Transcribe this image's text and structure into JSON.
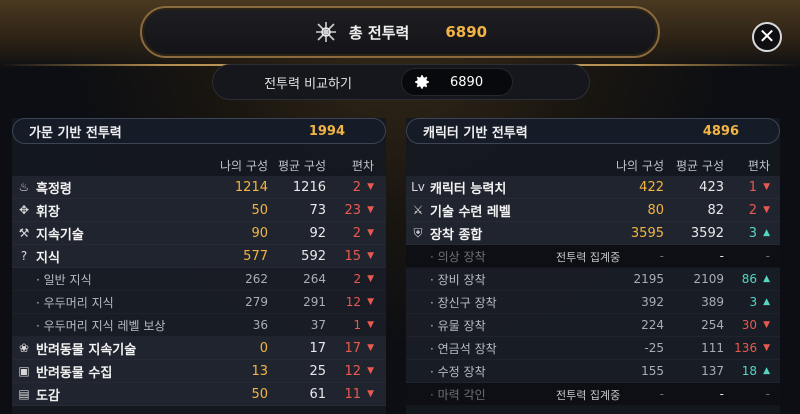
{
  "header": {
    "title": "총 전투력",
    "total": "6890",
    "close_icon": "close-icon",
    "title_icon": "combat-power-icon"
  },
  "compare": {
    "label": "전투력 비교하기",
    "value": "6890",
    "icon": "gear-icon"
  },
  "columns": {
    "mine": "나의 구성",
    "avg": "평균 구성",
    "dev": "편차"
  },
  "left_panel": {
    "title": "가문 기반 전투력",
    "total": "1994",
    "rows": [
      {
        "type": "main",
        "icon": "flame-icon",
        "icon_char": "♨",
        "name": "흑정령",
        "mine": "1214",
        "avg": "1216",
        "dev": "2",
        "dir": "up",
        "hi": true
      },
      {
        "type": "main",
        "icon": "crest-icon",
        "icon_char": "✥",
        "name": "휘장",
        "mine": "50",
        "avg": "73",
        "dev": "23",
        "dir": "up",
        "hi": true
      },
      {
        "type": "main",
        "icon": "crossed-tools-icon",
        "icon_char": "⚒",
        "name": "지속기술",
        "mine": "90",
        "avg": "92",
        "dev": "2",
        "dir": "up",
        "hi": true
      },
      {
        "type": "main",
        "icon": "knowledge-icon",
        "icon_char": "?",
        "name": "지식",
        "mine": "577",
        "avg": "592",
        "dev": "15",
        "dir": "up",
        "hi": true
      },
      {
        "type": "sub",
        "name": "· 일반 지식",
        "mine": "262",
        "avg": "264",
        "dev": "2",
        "dir": "up"
      },
      {
        "type": "sub",
        "name": "· 우두머리 지식",
        "mine": "279",
        "avg": "291",
        "dev": "12",
        "dir": "up"
      },
      {
        "type": "sub",
        "name": "· 우두머리 지식 레벨 보상",
        "mine": "36",
        "avg": "37",
        "dev": "1",
        "dir": "up"
      },
      {
        "type": "main",
        "icon": "paw-icon",
        "icon_char": "❀",
        "name": "반려동물 지속기술",
        "mine": "0",
        "avg": "17",
        "dev": "17",
        "dir": "up",
        "hi": true
      },
      {
        "type": "main",
        "icon": "pet-collection-icon",
        "icon_char": "▣",
        "name": "반려동물 수집",
        "mine": "13",
        "avg": "25",
        "dev": "12",
        "dir": "up",
        "hi": true
      },
      {
        "type": "main",
        "icon": "codex-icon",
        "icon_char": "▤",
        "name": "도감",
        "mine": "50",
        "avg": "61",
        "dev": "11",
        "dir": "up",
        "hi": true
      }
    ]
  },
  "right_panel": {
    "title": "캐릭터 기반 전투력",
    "total": "4896",
    "rows": [
      {
        "type": "main",
        "icon": "level-icon",
        "icon_char": "Lv",
        "name": "캐릭터 능력치",
        "mine": "422",
        "avg": "423",
        "dev": "1",
        "dir": "up",
        "hi": true
      },
      {
        "type": "main",
        "icon": "crossed-swords-icon",
        "icon_char": "⚔",
        "name": "기술 수련 레벨",
        "mine": "80",
        "avg": "82",
        "dev": "2",
        "dir": "up",
        "hi": true
      },
      {
        "type": "main",
        "icon": "armor-icon",
        "icon_char": "⛨",
        "name": "장착 종합",
        "mine": "3595",
        "avg": "3592",
        "dev": "3",
        "dir": "down",
        "hi": true
      },
      {
        "type": "dim",
        "name": "· 의상 장착",
        "mine": "-",
        "avg": "-",
        "dev": "-",
        "dir": "none",
        "note": "전투력 집계중"
      },
      {
        "type": "sub",
        "name": "· 장비 장착",
        "mine": "2195",
        "avg": "2109",
        "dev": "86",
        "dir": "down"
      },
      {
        "type": "sub",
        "name": "· 장신구 장착",
        "mine": "392",
        "avg": "389",
        "dev": "3",
        "dir": "down"
      },
      {
        "type": "sub",
        "name": "· 유물 장착",
        "mine": "224",
        "avg": "254",
        "dev": "30",
        "dir": "up"
      },
      {
        "type": "sub",
        "name": "· 연금석 장착",
        "mine": "-25",
        "avg": "111",
        "dev": "136",
        "dir": "up"
      },
      {
        "type": "sub",
        "name": "· 수정 장착",
        "mine": "155",
        "avg": "137",
        "dev": "18",
        "dir": "down"
      },
      {
        "type": "dim",
        "name": "· 마력 각인",
        "mine": "-",
        "avg": "-",
        "dev": "-",
        "dir": "none",
        "note": "전투력 집계중"
      }
    ]
  },
  "colors": {
    "accent": "#f2b544",
    "up": "#e85a4f",
    "down": "#55d6c2",
    "frame": "#8b6a3e"
  }
}
